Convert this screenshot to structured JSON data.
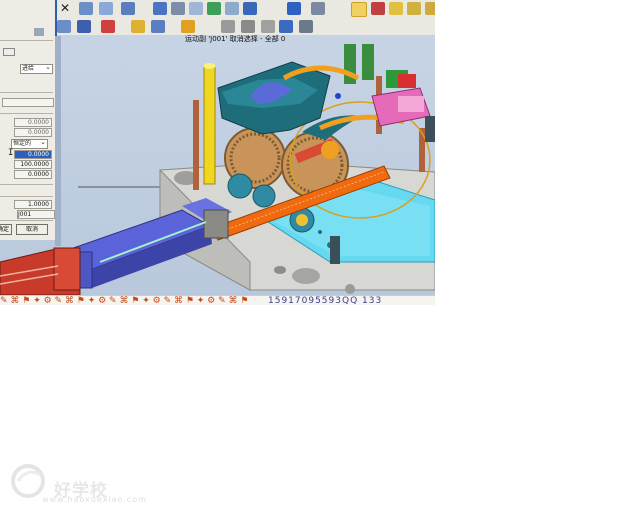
{
  "cue": {
    "text": "运动副 'J001' 取消选择 - 全部 0"
  },
  "dialog": {
    "select_value": "进给",
    "fields": [
      "0.0000",
      "0.0000"
    ],
    "mode_value": "恒定的",
    "values": [
      "0.0000",
      "100.0000",
      "0.0000"
    ],
    "scale": "1.0000",
    "joint_name": "J001",
    "ok_label": "确定",
    "cancel_label": "取消"
  },
  "status": {
    "text": "15917095593QQ 133"
  },
  "watermark": {
    "brand": "好学校",
    "url": "www.haoxuexiao.com"
  },
  "colors": {
    "dialog_border": "#2f5da8",
    "viewport_bg": "#c6d3e4",
    "rack": "#f06a10",
    "plate": "#66d8f0",
    "cylinder": "#5a63d8",
    "clamp": "#1e6d7a"
  }
}
